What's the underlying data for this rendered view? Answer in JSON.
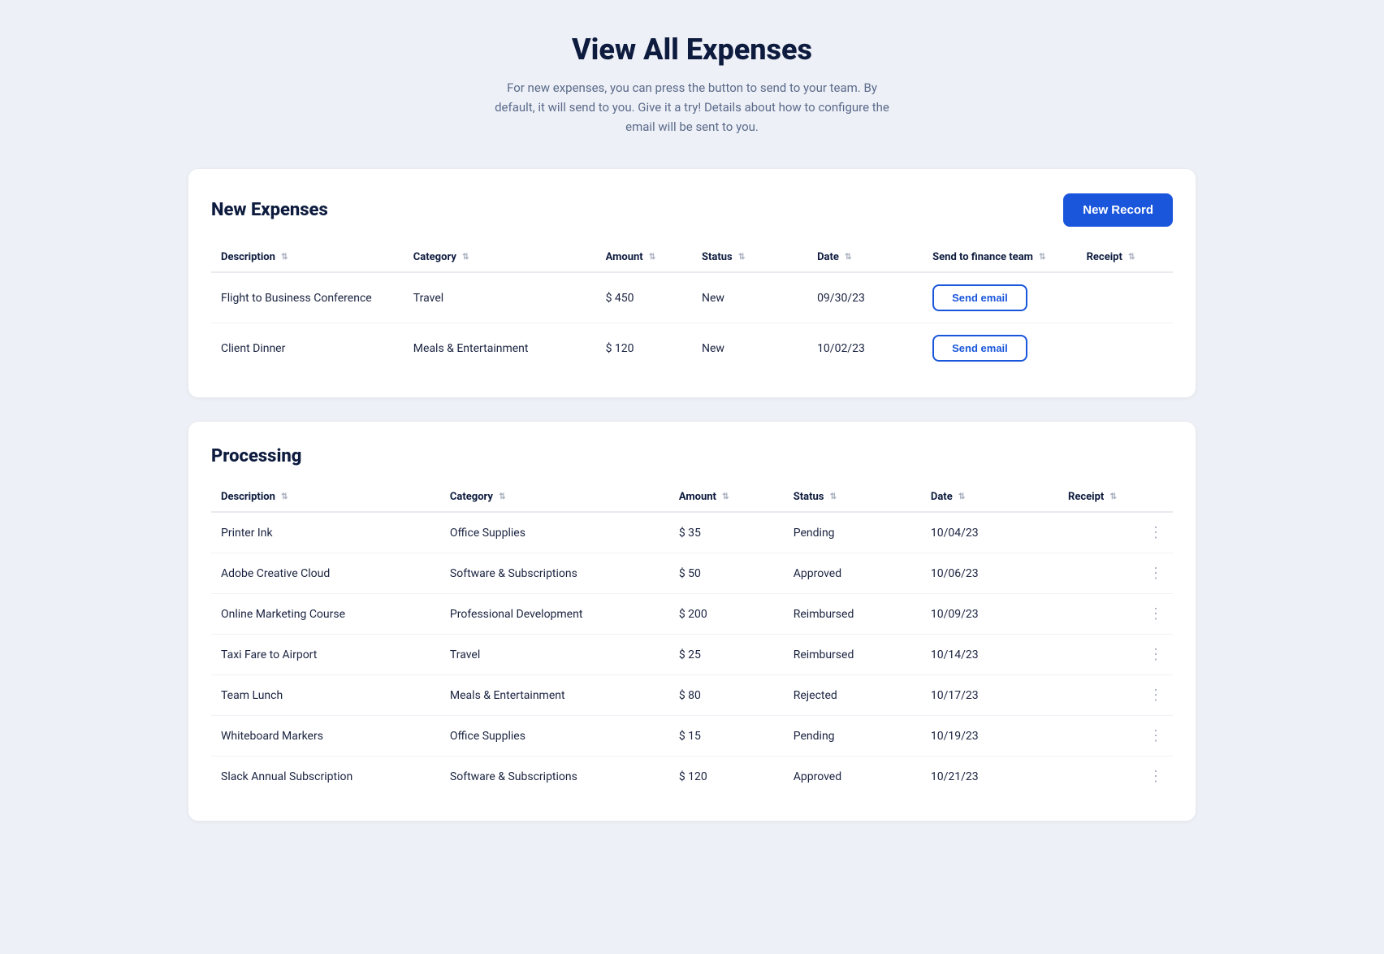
{
  "page": {
    "title": "View All Expenses",
    "subtitle": "For new expenses, you can press the button to send to your team. By default, it will send to you. Give it a try! Details about how to configure the email will be sent to you."
  },
  "new_expenses": {
    "section_title": "New Expenses",
    "new_record_btn": "New Record",
    "columns": [
      {
        "label": "Description",
        "key": "description"
      },
      {
        "label": "Category",
        "key": "category"
      },
      {
        "label": "Amount",
        "key": "amount"
      },
      {
        "label": "Status",
        "key": "status"
      },
      {
        "label": "Date",
        "key": "date"
      },
      {
        "label": "Send to finance team",
        "key": "send"
      },
      {
        "label": "Receipt",
        "key": "receipt"
      }
    ],
    "rows": [
      {
        "description": "Flight to Business Conference",
        "category": "Travel",
        "amount": "$ 450",
        "status": "New",
        "date": "09/30/23",
        "send_label": "Send email",
        "receipt": ""
      },
      {
        "description": "Client Dinner",
        "category": "Meals & Entertainment",
        "amount": "$ 120",
        "status": "New",
        "date": "10/02/23",
        "send_label": "Send email",
        "receipt": ""
      }
    ]
  },
  "processing": {
    "section_title": "Processing",
    "columns": [
      {
        "label": "Description",
        "key": "description"
      },
      {
        "label": "Category",
        "key": "category"
      },
      {
        "label": "Amount",
        "key": "amount"
      },
      {
        "label": "Status",
        "key": "status"
      },
      {
        "label": "Date",
        "key": "date"
      },
      {
        "label": "Receipt",
        "key": "receipt"
      }
    ],
    "rows": [
      {
        "description": "Printer Ink",
        "category": "Office Supplies",
        "amount": "$ 35",
        "status": "Pending",
        "date": "10/04/23",
        "receipt": ""
      },
      {
        "description": "Adobe Creative Cloud",
        "category": "Software & Subscriptions",
        "amount": "$ 50",
        "status": "Approved",
        "date": "10/06/23",
        "receipt": ""
      },
      {
        "description": "Online Marketing Course",
        "category": "Professional Development",
        "amount": "$ 200",
        "status": "Reimbursed",
        "date": "10/09/23",
        "receipt": ""
      },
      {
        "description": "Taxi Fare to Airport",
        "category": "Travel",
        "amount": "$ 25",
        "status": "Reimbursed",
        "date": "10/14/23",
        "receipt": ""
      },
      {
        "description": "Team Lunch",
        "category": "Meals & Entertainment",
        "amount": "$ 80",
        "status": "Rejected",
        "date": "10/17/23",
        "receipt": ""
      },
      {
        "description": "Whiteboard Markers",
        "category": "Office Supplies",
        "amount": "$ 15",
        "status": "Pending",
        "date": "10/19/23",
        "receipt": ""
      },
      {
        "description": "Slack Annual Subscription",
        "category": "Software & Subscriptions",
        "amount": "$ 120",
        "status": "Approved",
        "date": "10/21/23",
        "receipt": ""
      }
    ]
  }
}
